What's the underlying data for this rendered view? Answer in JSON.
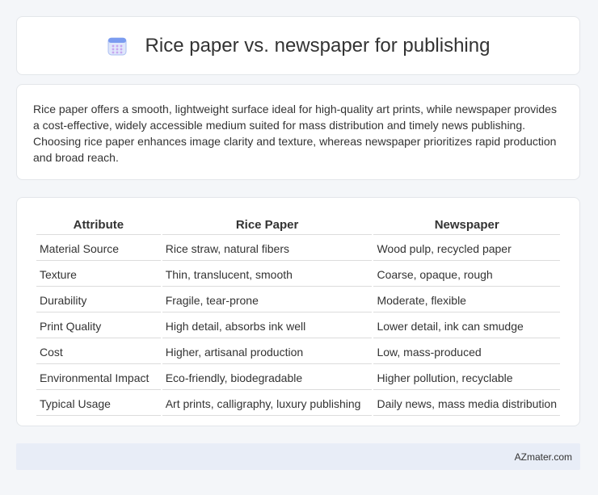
{
  "header": {
    "title": "Rice paper vs. newspaper for publishing",
    "icon": "calendar-icon",
    "icon_color": "#6c8fe6"
  },
  "summary": {
    "text": "Rice paper offers a smooth, lightweight surface ideal for high-quality art prints, while newspaper provides a cost-effective, widely accessible medium suited for mass distribution and timely news publishing. Choosing rice paper enhances image clarity and texture, whereas newspaper prioritizes rapid production and broad reach."
  },
  "table": {
    "headers": [
      "Attribute",
      "Rice Paper",
      "Newspaper"
    ],
    "rows": [
      [
        "Material Source",
        "Rice straw, natural fibers",
        "Wood pulp, recycled paper"
      ],
      [
        "Texture",
        "Thin, translucent, smooth",
        "Coarse, opaque, rough"
      ],
      [
        "Durability",
        "Fragile, tear-prone",
        "Moderate, flexible"
      ],
      [
        "Print Quality",
        "High detail, absorbs ink well",
        "Lower detail, ink can smudge"
      ],
      [
        "Cost",
        "Higher, artisanal production",
        "Low, mass-produced"
      ],
      [
        "Environmental Impact",
        "Eco-friendly, biodegradable",
        "Higher pollution, recyclable"
      ],
      [
        "Typical Usage",
        "Art prints, calligraphy, luxury publishing",
        "Daily news, mass media distribution"
      ]
    ]
  },
  "footer": {
    "brand": "AZmater.com"
  }
}
